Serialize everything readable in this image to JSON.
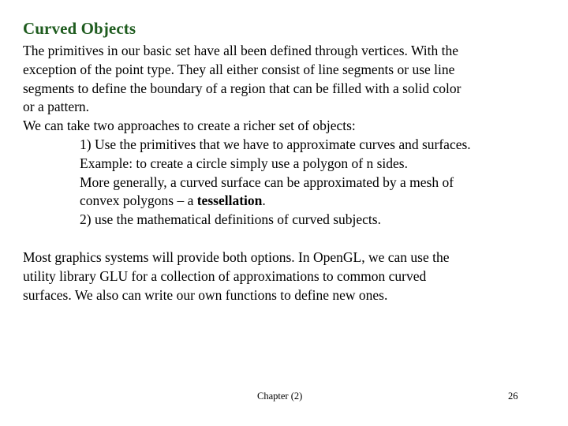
{
  "slide": {
    "title": "Curved Objects",
    "title_color": "#1f5c1f",
    "background_color": "#ffffff",
    "text_color": "#000000",
    "paragraphs": [
      {
        "id": "intro",
        "lines": [
          {
            "text": "The primitives in our basic set have all been defined through vertices.  With the",
            "indent": false
          },
          {
            "text": "exception of the point type.  They all either consist of line segments or use line",
            "indent": false
          },
          {
            "text": "segments to define the boundary of a region that can be filled with a solid color",
            "indent": false
          },
          {
            "text": "or a pattern.",
            "indent": false
          },
          {
            "text": "We can take two approaches to create a richer set of objects:",
            "indent": false
          },
          {
            "text": "1) Use the primitives that we have to approximate curves and surfaces.",
            "indent": true
          },
          {
            "text": "Example: to create a circle simply use a polygon of n sides.",
            "indent": true
          },
          {
            "text": "More generally, a curved surface can be approximated by a mesh of",
            "indent": true
          },
          {
            "text": "convex polygons – a ",
            "bold_text": "tessellation",
            "text_after": ".",
            "indent": true
          },
          {
            "text": "2) use the mathematical definitions of curved subjects.",
            "indent": true
          }
        ]
      },
      {
        "id": "closing",
        "lines": [
          {
            "text": "Most graphics systems will provide both options.  In OpenGL, we can use the",
            "indent": false
          },
          {
            "text": "utility library GLU for a collection of approximations to common curved",
            "indent": false
          },
          {
            "text": "surfaces.  We also can write our own functions to define new ones.",
            "indent": false
          }
        ]
      }
    ]
  },
  "footer": {
    "chapter_label": "Chapter (2)",
    "page_number": "26"
  }
}
